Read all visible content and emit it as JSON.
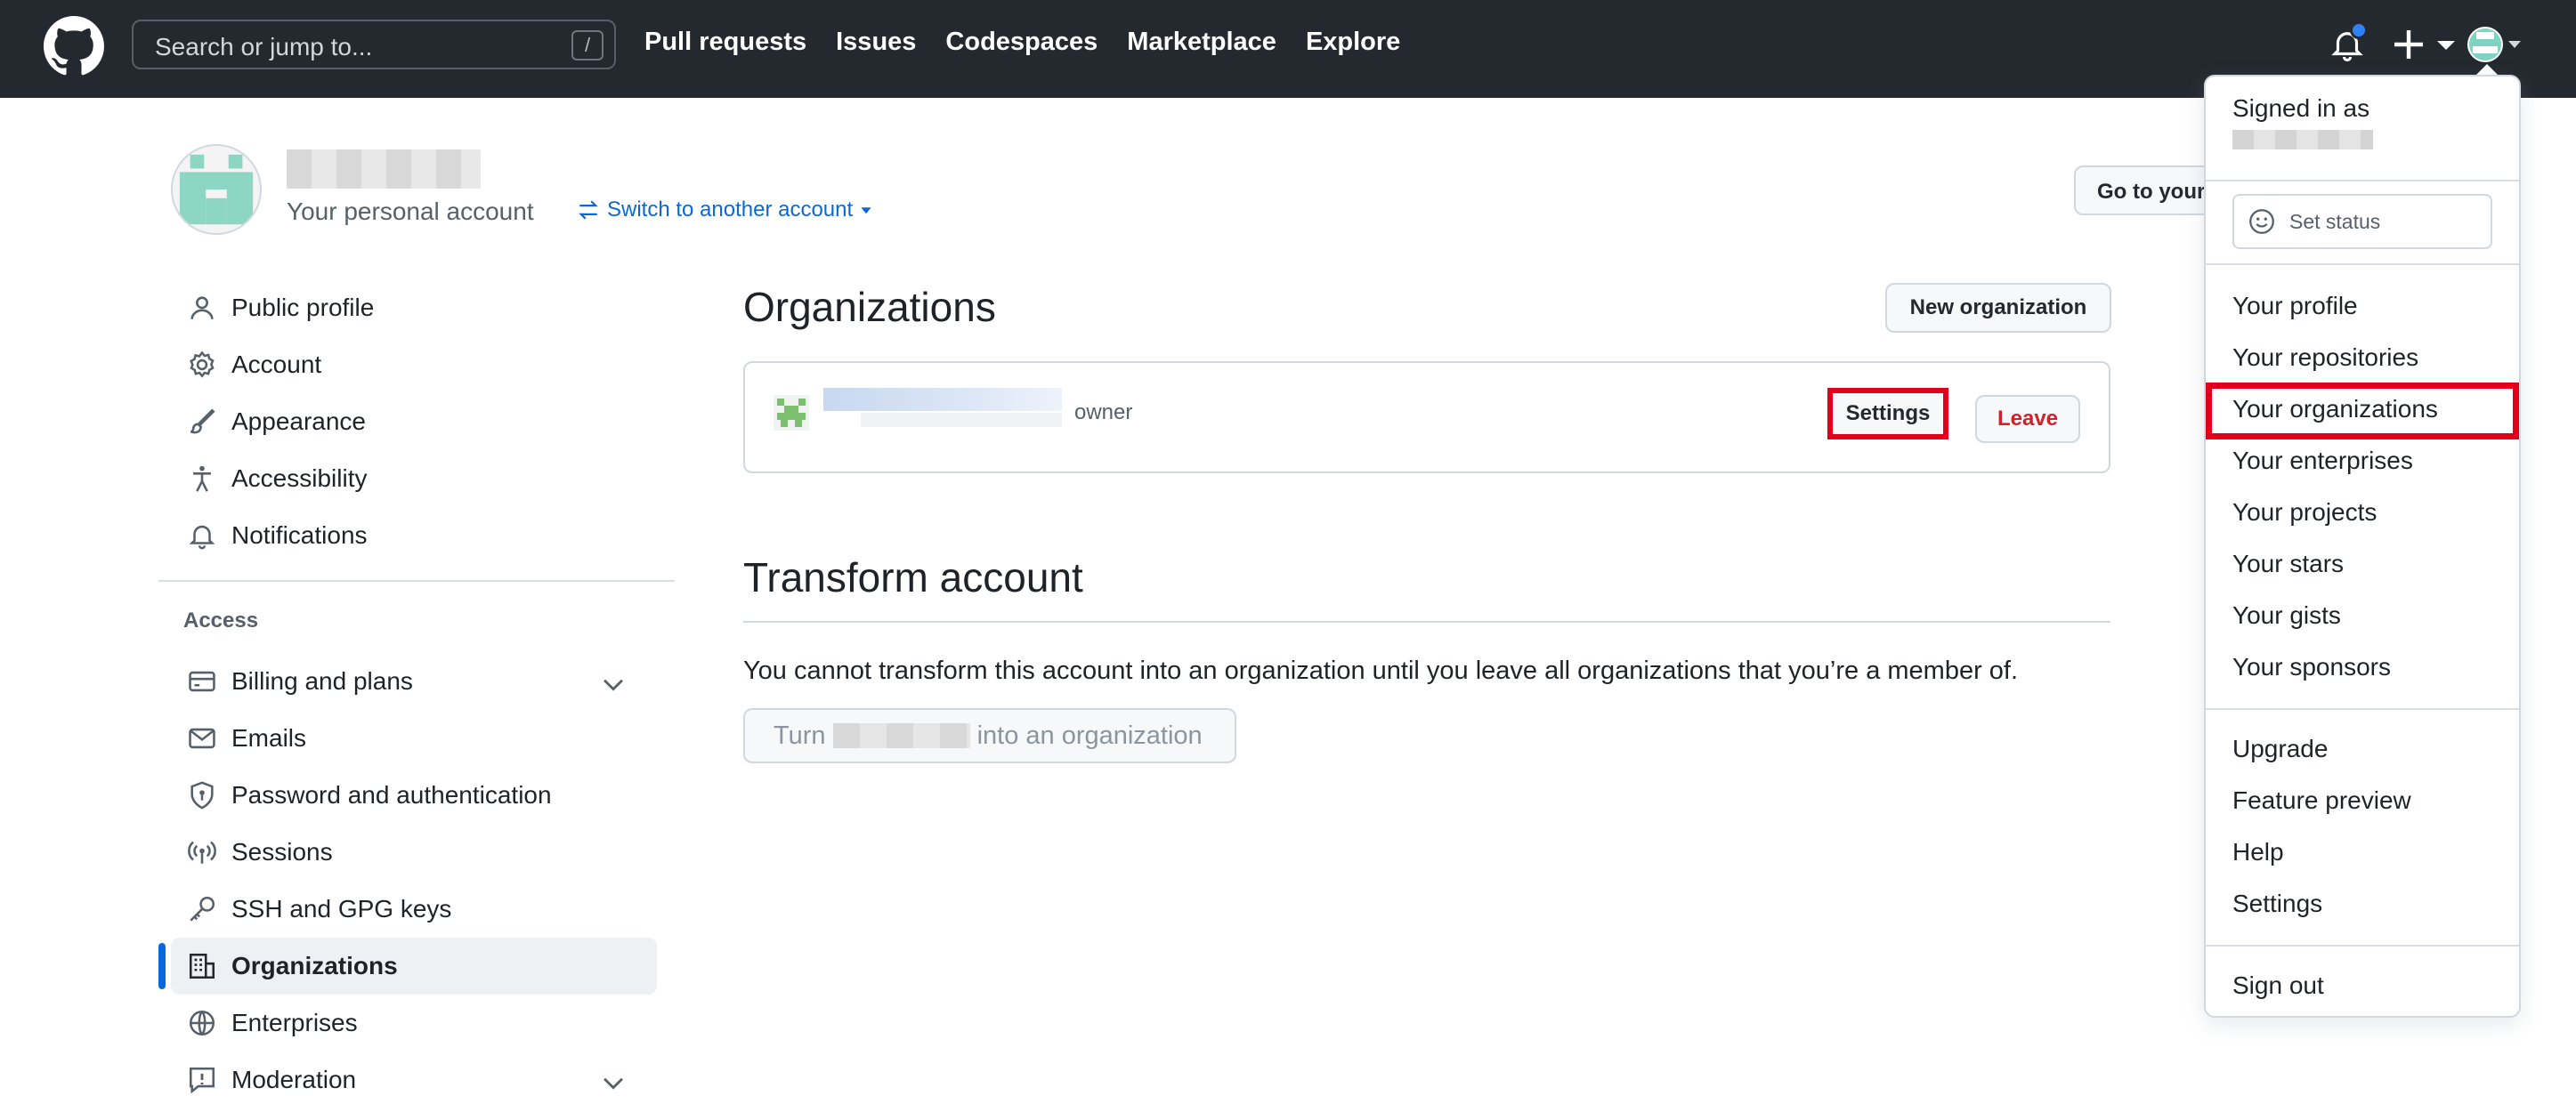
{
  "header": {
    "search_placeholder": "Search or jump to...",
    "search_shortcut": "/",
    "nav": [
      "Pull requests",
      "Issues",
      "Codespaces",
      "Marketplace",
      "Explore"
    ]
  },
  "profile": {
    "subtitle": "Your personal account",
    "switch_label": "Switch to another account",
    "goto_label": "Go to your"
  },
  "sidebar": {
    "items": [
      "Public profile",
      "Account",
      "Appearance",
      "Accessibility",
      "Notifications"
    ],
    "access_heading": "Access",
    "access_items": [
      "Billing and plans",
      "Emails",
      "Password and authentication",
      "Sessions",
      "SSH and GPG keys",
      "Organizations",
      "Enterprises",
      "Moderation"
    ]
  },
  "main": {
    "orgs_title": "Organizations",
    "new_org": "New organization",
    "org_role": "owner",
    "settings": "Settings",
    "leave": "Leave",
    "transform_title": "Transform account",
    "transform_text": "You cannot transform this account into an organization until you leave all organizations that you’re a member of.",
    "turn_prefix": "Turn",
    "turn_suffix": "into an organization"
  },
  "dropdown": {
    "signed_in": "Signed in as",
    "set_status": "Set status",
    "group1": [
      "Your profile",
      "Your repositories",
      "Your organizations",
      "Your enterprises",
      "Your projects",
      "Your stars",
      "Your gists",
      "Your sponsors"
    ],
    "group2": [
      "Upgrade",
      "Feature preview",
      "Help",
      "Settings"
    ],
    "sign_out": "Sign out"
  },
  "colors": {
    "header_bg": "#24292f",
    "link": "#0969da",
    "highlight": "#e0001b",
    "danger": "#cf222e"
  }
}
